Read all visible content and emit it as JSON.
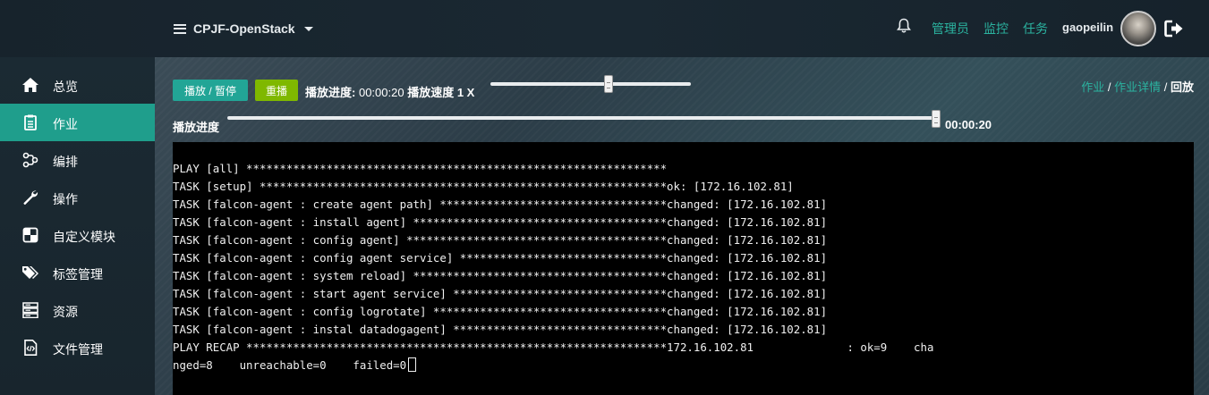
{
  "header": {
    "project_name": "CPJF-OpenStack",
    "nav_links": [
      "管理员",
      "监控",
      "任务"
    ],
    "username": "gaopeilin"
  },
  "sidebar": {
    "items": [
      {
        "label": "总览",
        "icon": "home-icon",
        "active": false
      },
      {
        "label": "作业",
        "icon": "clipboard-icon",
        "active": true
      },
      {
        "label": "编排",
        "icon": "flow-icon",
        "active": false
      },
      {
        "label": "操作",
        "icon": "wrench-icon",
        "active": false
      },
      {
        "label": "自定义模块",
        "icon": "module-icon",
        "active": false
      },
      {
        "label": "标签管理",
        "icon": "tags-icon",
        "active": false
      },
      {
        "label": "资源",
        "icon": "server-icon",
        "active": false
      },
      {
        "label": "文件管理",
        "icon": "file-code-icon",
        "active": false
      }
    ],
    "active_color": "#1f9e8c"
  },
  "player": {
    "play_pause_label": "播放 / 暂停",
    "replay_label": "重播",
    "progress_prefix": "播放进度:",
    "progress_time": "00:00:20",
    "speed_label": "播放速度 1 X",
    "speed_level": 0.57,
    "bar_label": "播放进度",
    "bar_time": "00:00:20",
    "bar_level": 1.0
  },
  "breadcrumb": {
    "items": [
      "作业",
      "作业详情"
    ],
    "current": "回放",
    "separator": "/"
  },
  "terminal": {
    "lines": [
      "PLAY [all] ***************************************************************",
      "TASK [setup] *************************************************************ok: [172.16.102.81]",
      "TASK [falcon-agent : create agent path] **********************************changed: [172.16.102.81]",
      "TASK [falcon-agent : install agent] **************************************changed: [172.16.102.81]",
      "TASK [falcon-agent : config agent] ***************************************changed: [172.16.102.81]",
      "TASK [falcon-agent : config agent service] *******************************changed: [172.16.102.81]",
      "TASK [falcon-agent : system reload] **************************************changed: [172.16.102.81]",
      "TASK [falcon-agent : start agent service] ********************************changed: [172.16.102.81]",
      "TASK [falcon-agent : config logrotate] ***********************************changed: [172.16.102.81]",
      "TASK [falcon-agent : instal datadogagent] ********************************changed: [172.16.102.81]",
      "PLAY RECAP ***************************************************************172.16.102.81              : ok=9    cha",
      "nged=8    unreachable=0    failed=0"
    ]
  },
  "colors": {
    "accent": "#2bb3a0",
    "play_button": "#22a596",
    "replay_button": "#7fb800",
    "terminal_bg": "#000000"
  }
}
